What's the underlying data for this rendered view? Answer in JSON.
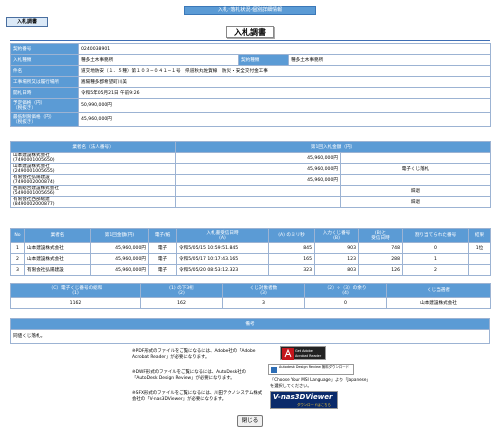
{
  "header": {
    "top_title": "入札･落札状況-個別詳細情報",
    "tab_label": "入札調書",
    "page_title": "入札調書"
  },
  "summary": {
    "rows": [
      {
        "label": "契約番号",
        "value": "0240038901"
      },
      {
        "label": "入札種類",
        "value": "種多土木事務所",
        "label2": "契約種類",
        "value2": "種多土木事務所"
      },
      {
        "label": "件名",
        "value": "道交地防安（１．５種）第１０３−０４１−１号　県道秋丸佐賀線　防災・安全交付金工事"
      },
      {
        "label": "工事場所又は履行場所",
        "value": "嵩陽種多郡希望町川美"
      },
      {
        "label": "開札日時",
        "value": "令和5年05月21日 午前9:26"
      },
      {
        "label": "予定価格（円）\n（税抜き）",
        "value": "50,990,000円"
      },
      {
        "label": "最低制限価格（円）\n（税抜き）",
        "value": "45,960,000円"
      }
    ]
  },
  "bids": {
    "headers": [
      "業者名（法人番号）",
      "第1回入札金額（円）"
    ],
    "rows": [
      {
        "name": "山本建設株式会社",
        "num": "(7490001005650)",
        "amount": "45,960,000円",
        "note": ""
      },
      {
        "name": "山本建設株式会社",
        "num": "(2490001005655)",
        "amount": "45,960,000円",
        "note": "電子くじ落札"
      },
      {
        "name": "有限会社弘陽建設",
        "num": "(7490002000874)",
        "amount": "45,960,000円",
        "note": ""
      },
      {
        "name": "西南総合建設株式会社",
        "num": "(5490001005656)",
        "amount": "",
        "note": "辞退"
      },
      {
        "name": "有限会社西部総建",
        "num": "(8490002000877)",
        "amount": "",
        "note": "辞退"
      }
    ]
  },
  "lottery": {
    "headers": [
      "No",
      "業者名",
      "第1回金額(円)",
      "電子/紙",
      "入札書受信日時\n(A)",
      "(A) のミリ秒",
      "入力くじ番号\n(B)",
      "(B)と\n受信日時",
      "割り当てられた番号",
      "結果"
    ],
    "rows": [
      {
        "no": "1",
        "name": "山本建設株式会社",
        "amount": "45,960,000円",
        "type": "電子",
        "time": "令和5/05/15 10:59:51.845",
        "ms": "845",
        "kuji": "903",
        "sum": "748",
        "assigned": "0",
        "result": "1位"
      },
      {
        "no": "2",
        "name": "山本建設株式会社",
        "amount": "45,960,000円",
        "type": "電子",
        "time": "令和5/05/17 10:17:43.165",
        "ms": "165",
        "kuji": "123",
        "sum": "288",
        "assigned": "1",
        "result": ""
      },
      {
        "no": "3",
        "name": "有限会社弘陽建設",
        "amount": "45,960,000円",
        "type": "電子",
        "time": "令和5/05/20 08:53:12.323",
        "ms": "323",
        "kuji": "803",
        "sum": "126",
        "assigned": "2",
        "result": ""
      }
    ]
  },
  "calc": {
    "headers": [
      "（C）電子くじ番号の総和\n(1)",
      "(1) の下3桁\n(2)",
      "くじ対象者数\n(3)",
      "（2）÷（3）の余り\n(4)",
      "くじ当選者"
    ],
    "values": [
      "1162",
      "162",
      "3",
      "0",
      "山本建設株式会社"
    ]
  },
  "remarks": {
    "header": "備考",
    "text": "同値くじ落札。"
  },
  "notices": {
    "pdf": "※PDF形式のファイルをご覧になるには、Adobe社の「Adobe Acrobat Reader」が必要になります。",
    "dwf": "※DWF形式のファイルをご覧になるには、AutoDesk社の「AutoDesk Design Review」が必要になります。",
    "sfx": "※SFX形式のファイルをご覧になるには、川田テクノシステム株式会社の「V-nas3DViewer」が必要になります。",
    "adobe_badge": "Get Adobe Acrobat Reader",
    "autodesk_badge": "Autodesk Design Review 無料ダウンロード",
    "autodesk_note": "「Choose Your MSI Language」より「Japanese」を選択してください。",
    "vnas_badge": "V-nas3DViewer",
    "vnas_sub": "ダウンロードはこちら"
  },
  "close_label": "閉じる",
  "colors": {
    "header_blue": "#5b9bd5",
    "border": "#9cb3d3"
  }
}
